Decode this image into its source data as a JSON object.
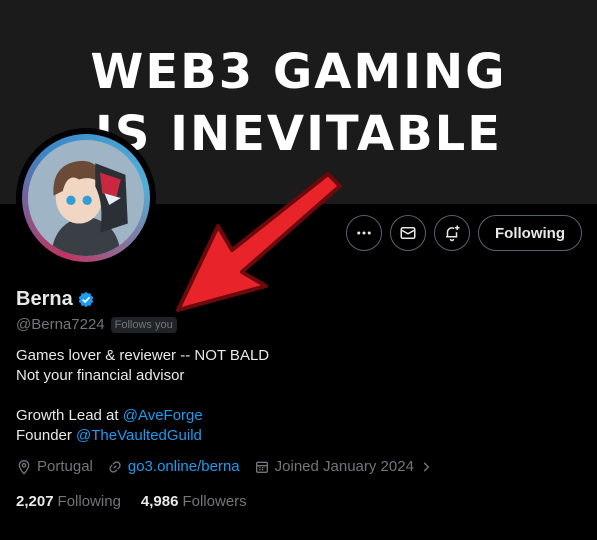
{
  "banner": {
    "line1": "WEB3 GAMING",
    "line2": "IS INEVITABLE"
  },
  "profile": {
    "display_name": "Berna",
    "handle": "@Berna7224",
    "follows_you": "Follows you",
    "verified_icon": "verified-badge-icon"
  },
  "actions": {
    "more_icon": "more-horizontal-icon",
    "message_icon": "envelope-icon",
    "notify_icon": "bell-plus-icon",
    "follow_label": "Following"
  },
  "bio": {
    "line1": "Games lover & reviewer -- NOT BALD",
    "line2": "Not your financial advisor",
    "growth_prefix": "Growth Lead at ",
    "growth_link": "@AveForge",
    "founder_prefix": "Founder ",
    "founder_link": "@TheVaultedGuild"
  },
  "meta": {
    "location": "Portugal",
    "website": "go3.online/berna",
    "joined": "Joined January 2024"
  },
  "stats": {
    "following_count": "2,207",
    "following_label": "Following",
    "followers_count": "4,986",
    "followers_label": "Followers"
  },
  "colors": {
    "background": "#000000",
    "text": "#e7e9ea",
    "muted": "#71767b",
    "link": "#1d9bf0",
    "verified": "#1d9bf0",
    "arrow": "#e8232a"
  }
}
